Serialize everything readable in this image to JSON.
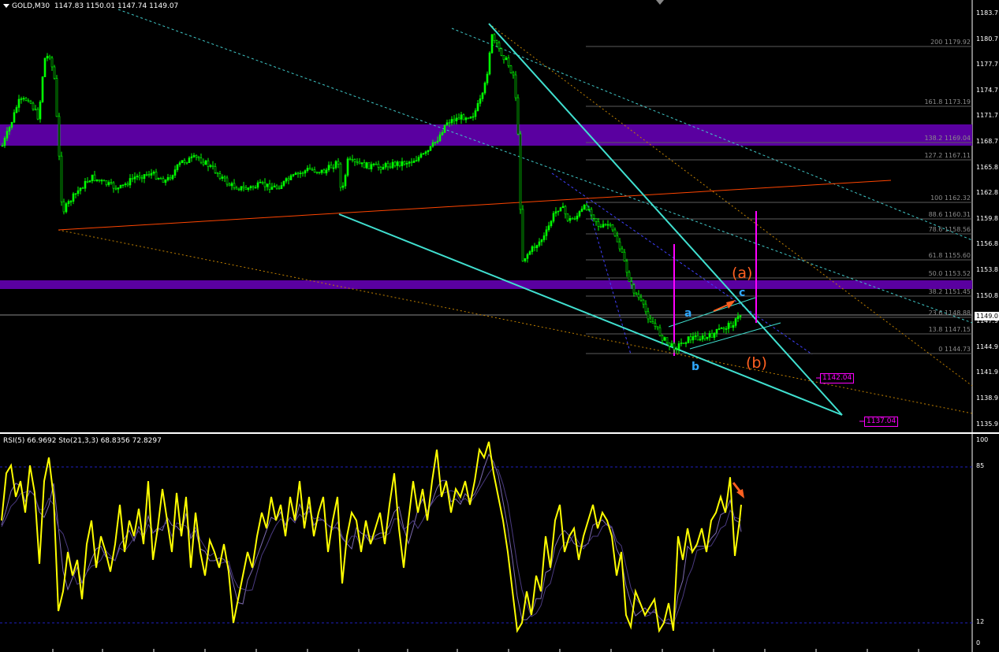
{
  "header": {
    "symbol": "GOLD,M30",
    "prices": "1147.83 1150.01 1147.74 1149.07"
  },
  "oscillator": {
    "label": "RSI(5) 66.9692  Sto(21,3,3) 68.8356 72.8297"
  },
  "price_axis": [
    "1183.7",
    "1180.7",
    "1177.7",
    "1174.7",
    "1171.7",
    "1168.7",
    "1165.8",
    "1162.8",
    "1159.8",
    "1156.8",
    "1153.8",
    "1150.8",
    "1147.9",
    "1144.9",
    "1141.9",
    "1138.9",
    "1135.9"
  ],
  "osc_axis": [
    "100",
    "85",
    "12",
    "0"
  ],
  "current_price": "1149.0",
  "fibo_levels": [
    "200 1179.92",
    "161.8 1173.19",
    "138.2 1169.04",
    "127.2 1167.11",
    "100 1162.32",
    "88.6 1160.31",
    "78.6 1158.56",
    "61.8 1155.60",
    "50.0 1153.52",
    "38.2 1151.45",
    "23.6 1148.88",
    "13.8 1147.15",
    "0 1144.73"
  ],
  "wave_labels": {
    "a_big": "(a)",
    "b_big": "(b)",
    "a": "a",
    "b": "b",
    "c": "c"
  },
  "targets": [
    "1142.04",
    "1137.04"
  ],
  "colors": {
    "candle": "#00ff00",
    "zone": "#5a00a0",
    "channel": "#40e0d0",
    "redline": "#ff4500",
    "fibo": "#6e6e6e",
    "rsi": "#ffff00",
    "stoch": "#7d6bb0",
    "magenta": "#ff00ff",
    "wave_orange": "#ff6020",
    "wave_blue": "#2fa8ff"
  }
}
